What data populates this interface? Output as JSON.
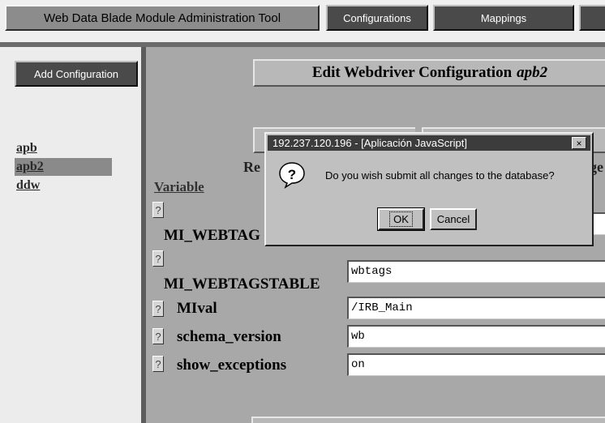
{
  "toolbar": {
    "title": "Web Data Blade Module Administration Tool",
    "configurations_label": "Configurations",
    "mappings_label": "Mappings"
  },
  "sidebar": {
    "add_label": "Add Configuration",
    "items": [
      {
        "label": "apb",
        "selected": false
      },
      {
        "label": "apb2",
        "selected": true
      },
      {
        "label": "ddw",
        "selected": false
      }
    ]
  },
  "main": {
    "header_text": "Edit Webdriver Configuration",
    "header_name": "apb2",
    "left_fragment": "Re",
    "right_fragment": "ge",
    "variable_header": "Variable",
    "help_label": "?",
    "rows": [
      {
        "name": "MI_WEBTAG",
        "value": ""
      },
      {
        "name": "MI_WEBTAGSTABLE",
        "value": "wbtags"
      },
      {
        "name": "MIval",
        "value": "/IRB_Main"
      },
      {
        "name": "schema_version",
        "value": "wb"
      },
      {
        "name": "show_exceptions",
        "value": "on"
      }
    ]
  },
  "dialog": {
    "title": "192.237.120.196 - [Aplicación JavaScript]",
    "close_label": "×",
    "icon": "question-icon",
    "message": "Do you wish submit all changes to the database?",
    "ok_label": "OK",
    "cancel_label": "Cancel"
  }
}
